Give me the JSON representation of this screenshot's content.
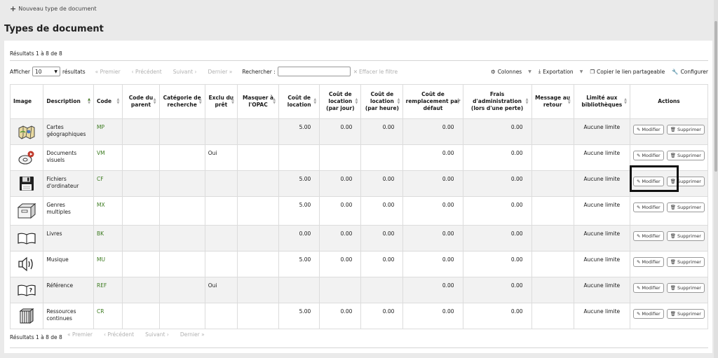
{
  "toolbar": {
    "new_label": "Nouveau type de document"
  },
  "page_title": "Types de document",
  "results_text": "Résultats 1 à 8 de 8",
  "controls": {
    "show_label": "Afficher",
    "page_size": "10",
    "results_label": "résultats",
    "first": "« Premier",
    "previous": "‹ Précédent",
    "next": "Suivant ›",
    "last": "Dernier »",
    "search_label": "Rechercher :",
    "search_placeholder": "",
    "clear_filter": "Effacer le filtre",
    "columns": "Colonnes",
    "export": "Exportation",
    "copy_link": "Copier le lien partageable",
    "configure": "Configurer"
  },
  "columns": {
    "image": "Image",
    "description": "Description",
    "code": "Code",
    "parent": "Code du parent",
    "search_category": "Catégorie de recherche",
    "excluded": "Exclu du prêt",
    "hide_opac": "Masquer à l'OPAC",
    "rental": "Coût de location",
    "rental_day": "Coût de location (par jour)",
    "rental_hour": "Coût de location (par heure)",
    "replacement": "Coût de remplacement par défaut",
    "processing": "Frais d'administration (lors d'une perte)",
    "checkin_msg": "Message au retour",
    "limit": "Limité aux bibliothèques",
    "actions": "Actions"
  },
  "buttons": {
    "edit": "Modifier",
    "delete": "Supprimer"
  },
  "rows": [
    {
      "icon": "map-icon",
      "description": "Cartes géographiques",
      "code": "MP",
      "parent": "",
      "category": "",
      "excluded": "",
      "hide": "",
      "rental": "5.00",
      "rental_day": "0.00",
      "rental_hour": "0.00",
      "replacement": "0.00",
      "processing": "0.00",
      "message": "",
      "limit": "Aucune limite"
    },
    {
      "icon": "visual-media-icon",
      "description": "Documents visuels",
      "code": "VM",
      "parent": "",
      "category": "",
      "excluded": "Oui",
      "hide": "",
      "rental": "",
      "rental_day": "",
      "rental_hour": "",
      "replacement": "0.00",
      "processing": "0.00",
      "message": "",
      "limit": "Aucune limite"
    },
    {
      "icon": "floppy-disk-icon",
      "description": "Fichiers d'ordinateur",
      "code": "CF",
      "parent": "",
      "category": "",
      "excluded": "",
      "hide": "",
      "rental": "5.00",
      "rental_day": "0.00",
      "rental_hour": "0.00",
      "replacement": "0.00",
      "processing": "0.00",
      "message": "",
      "limit": "Aucune limite"
    },
    {
      "icon": "box-icon",
      "description": "Genres multiples",
      "code": "MX",
      "parent": "",
      "category": "",
      "excluded": "",
      "hide": "",
      "rental": "5.00",
      "rental_day": "0.00",
      "rental_hour": "0.00",
      "replacement": "0.00",
      "processing": "0.00",
      "message": "",
      "limit": "Aucune limite"
    },
    {
      "icon": "open-book-icon",
      "description": "Livres",
      "code": "BK",
      "parent": "",
      "category": "",
      "excluded": "",
      "hide": "",
      "rental": "0.00",
      "rental_day": "0.00",
      "rental_hour": "0.00",
      "replacement": "0.00",
      "processing": "0.00",
      "message": "",
      "limit": "Aucune limite"
    },
    {
      "icon": "speaker-icon",
      "description": "Musique",
      "code": "MU",
      "parent": "",
      "category": "",
      "excluded": "",
      "hide": "",
      "rental": "5.00",
      "rental_day": "0.00",
      "rental_hour": "0.00",
      "replacement": "0.00",
      "processing": "0.00",
      "message": "",
      "limit": "Aucune limite"
    },
    {
      "icon": "reference-book-icon",
      "description": "Référence",
      "code": "REF",
      "parent": "",
      "category": "",
      "excluded": "Oui",
      "hide": "",
      "rental": "",
      "rental_day": "",
      "rental_hour": "",
      "replacement": "0.00",
      "processing": "0.00",
      "message": "",
      "limit": "Aucune limite"
    },
    {
      "icon": "books-stack-icon",
      "description": "Ressources continues",
      "code": "CR",
      "parent": "",
      "category": "",
      "excluded": "",
      "hide": "",
      "rental": "5.00",
      "rental_day": "0.00",
      "rental_hour": "0.00",
      "replacement": "0.00",
      "processing": "0.00",
      "message": "",
      "limit": "Aucune limite"
    }
  ]
}
